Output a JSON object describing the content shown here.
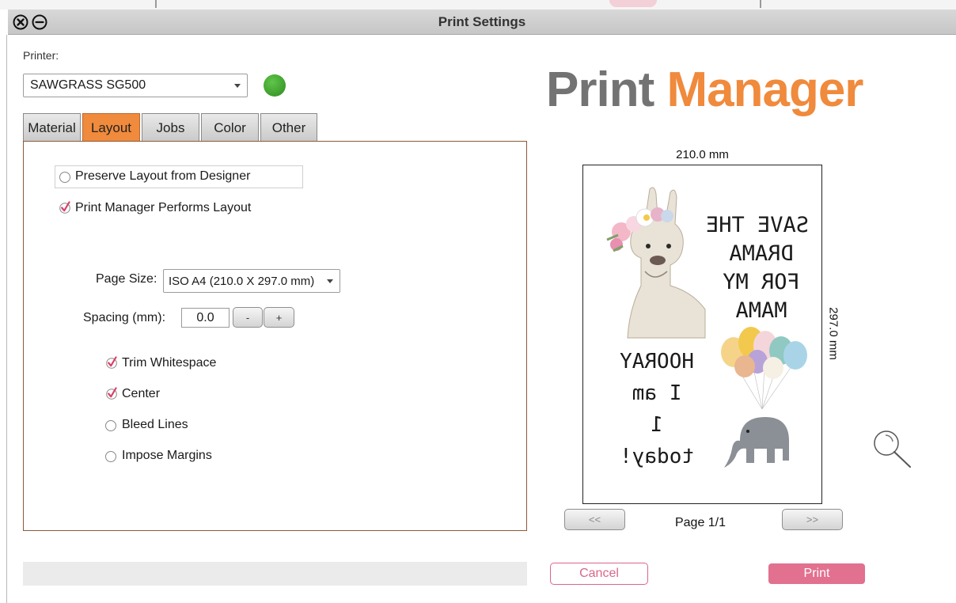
{
  "window": {
    "title": "Print Settings"
  },
  "printer": {
    "label": "Printer:",
    "selected": "SAWGRASS SG500",
    "status_color": "#3a9a2a"
  },
  "tabs": [
    {
      "label": "Material",
      "active": false
    },
    {
      "label": "Layout",
      "active": true
    },
    {
      "label": "Jobs",
      "active": false
    },
    {
      "label": "Color",
      "active": false
    },
    {
      "label": "Other",
      "active": false
    }
  ],
  "layout": {
    "preserve_layout": {
      "label": "Preserve Layout from Designer",
      "checked": false
    },
    "pm_layout": {
      "label": "Print Manager Performs Layout",
      "checked": true
    },
    "page_size": {
      "label": "Page Size:",
      "value": "ISO A4 (210.0 X 297.0 mm)"
    },
    "spacing": {
      "label": "Spacing (mm):",
      "value": "0.0",
      "minus": "-",
      "plus": "+"
    },
    "options": [
      {
        "label": "Trim Whitespace",
        "checked": true
      },
      {
        "label": "Center",
        "checked": true
      },
      {
        "label": "Bleed Lines",
        "checked": false
      },
      {
        "label": "Impose Margins",
        "checked": false
      }
    ]
  },
  "logo": {
    "word1": "Print",
    "word2": "Manager",
    "color1": "#737373",
    "color2": "#f08a3c"
  },
  "preview": {
    "width_label": "210.0 mm",
    "height_label": "297.0 mm",
    "text_top": [
      "SAVE THE",
      "DRAMA",
      "FOR MY",
      "MAMA"
    ],
    "text_bottom": [
      "HOORAY",
      "I am",
      "1",
      "today!"
    ],
    "page_indicator": "Page 1/1",
    "prev_label": "<<",
    "next_label": ">>"
  },
  "actions": {
    "cancel": "Cancel",
    "print": "Print",
    "accent": "#e2708f"
  }
}
